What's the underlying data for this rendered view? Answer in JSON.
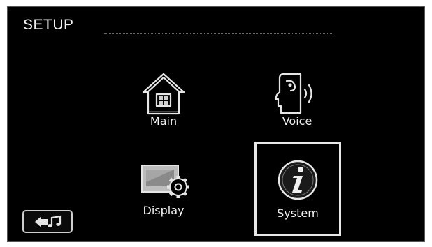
{
  "header": {
    "title": "SETUP"
  },
  "menu": {
    "items": [
      {
        "label": "Main",
        "icon": "house-icon"
      },
      {
        "label": "Voice",
        "icon": "speaking-head-icon"
      },
      {
        "label": "Display",
        "icon": "display-gear-icon"
      },
      {
        "label": "System",
        "icon": "info-icon",
        "selected": true
      }
    ]
  },
  "footer": {
    "back_icon": "back-arrow-music-note-icon"
  },
  "colors": {
    "background": "#000000",
    "text": "#f2f2f2",
    "selection_border": "#e8e8e8"
  }
}
